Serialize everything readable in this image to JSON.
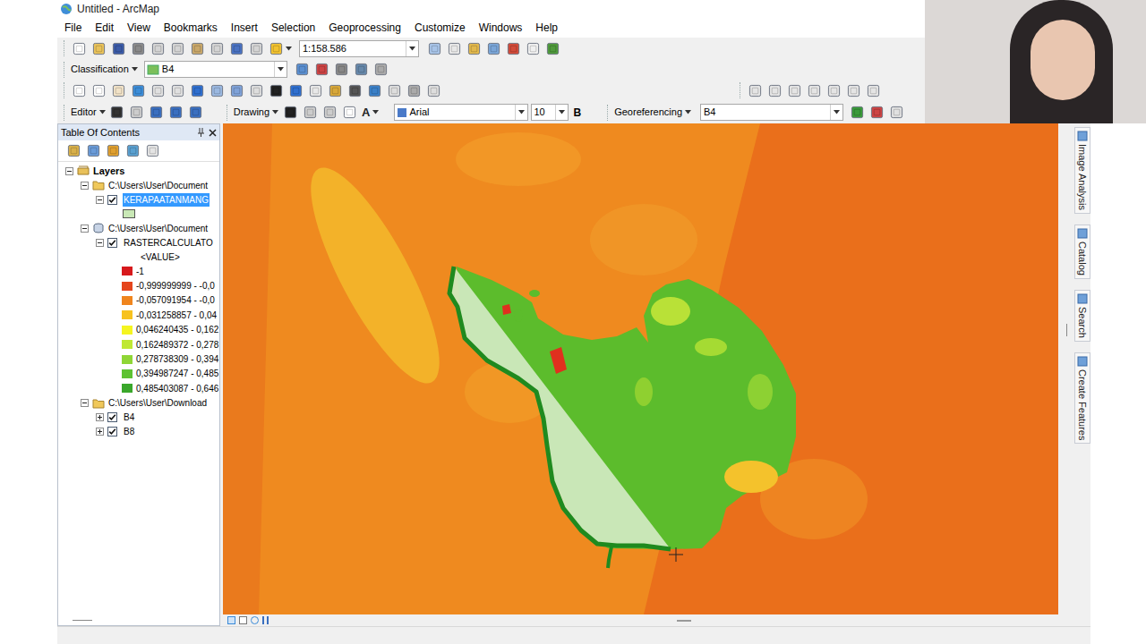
{
  "window": {
    "title": "Untitled - ArcMap"
  },
  "menu": [
    "File",
    "Edit",
    "View",
    "Bookmarks",
    "Insert",
    "Selection",
    "Geoprocessing",
    "Customize",
    "Windows",
    "Help"
  ],
  "standard_toolbar": {
    "scale": "1:158.586"
  },
  "classification_toolbar": {
    "label": "Classification",
    "layer": "B4"
  },
  "editor_toolbar": {
    "label": "Editor"
  },
  "drawing_toolbar": {
    "label": "Drawing",
    "text_tool": "A",
    "font": "Arial",
    "size": "10",
    "bold": "B"
  },
  "georeferencing_toolbar": {
    "label": "Georeferencing",
    "layer": "B4"
  },
  "toc": {
    "title": "Table Of Contents",
    "root": {
      "label": "Layers",
      "expanded": true
    },
    "groups": [
      {
        "path": "C:\\Users\\User\\Document",
        "kind": "folder",
        "expanded": true,
        "layers": [
          {
            "name": "KERAPAATANMANG",
            "checked": true,
            "selected": true,
            "expanded": true,
            "legend": {
              "kind": "patch",
              "color": "#c9e8b6"
            }
          }
        ]
      },
      {
        "path": "C:\\Users\\User\\Document",
        "kind": "database",
        "expanded": true,
        "layers": [
          {
            "name": "RASTERCALCULATO",
            "checked": true,
            "selected": false,
            "expanded": true,
            "legend": {
              "kind": "classes",
              "field": "<VALUE>",
              "classes": [
                {
                  "label": "-1",
                  "color": "#d7191c"
                },
                {
                  "label": "-0,999999999 - -0,0",
                  "color": "#e5451c"
                },
                {
                  "label": "-0,057091954 - -0,0",
                  "color": "#f0851d"
                },
                {
                  "label": "-0,031258857 - 0,04",
                  "color": "#f7c21f"
                },
                {
                  "label": "0,046240435 - 0,162",
                  "color": "#f5f520"
                },
                {
                  "label": "0,162489372 - 0,278",
                  "color": "#bfe834"
                },
                {
                  "label": "0,278738309 - 0,394",
                  "color": "#8fd636"
                },
                {
                  "label": "0,394987247 - 0,485",
                  "color": "#5ec232"
                },
                {
                  "label": "0,485403087 - 0,646",
                  "color": "#3aa72b"
                }
              ]
            }
          }
        ]
      },
      {
        "path": "C:\\Users\\User\\Download",
        "kind": "folder",
        "expanded": true,
        "layers": [
          {
            "name": "B4",
            "checked": true,
            "selected": false,
            "expanded": false
          },
          {
            "name": "B8",
            "checked": true,
            "selected": false,
            "expanded": false
          }
        ]
      }
    ]
  },
  "dock_tabs": [
    {
      "label": "Image Analysis"
    },
    {
      "label": "Catalog"
    },
    {
      "label": "Search"
    },
    {
      "label": "Create Features"
    }
  ]
}
